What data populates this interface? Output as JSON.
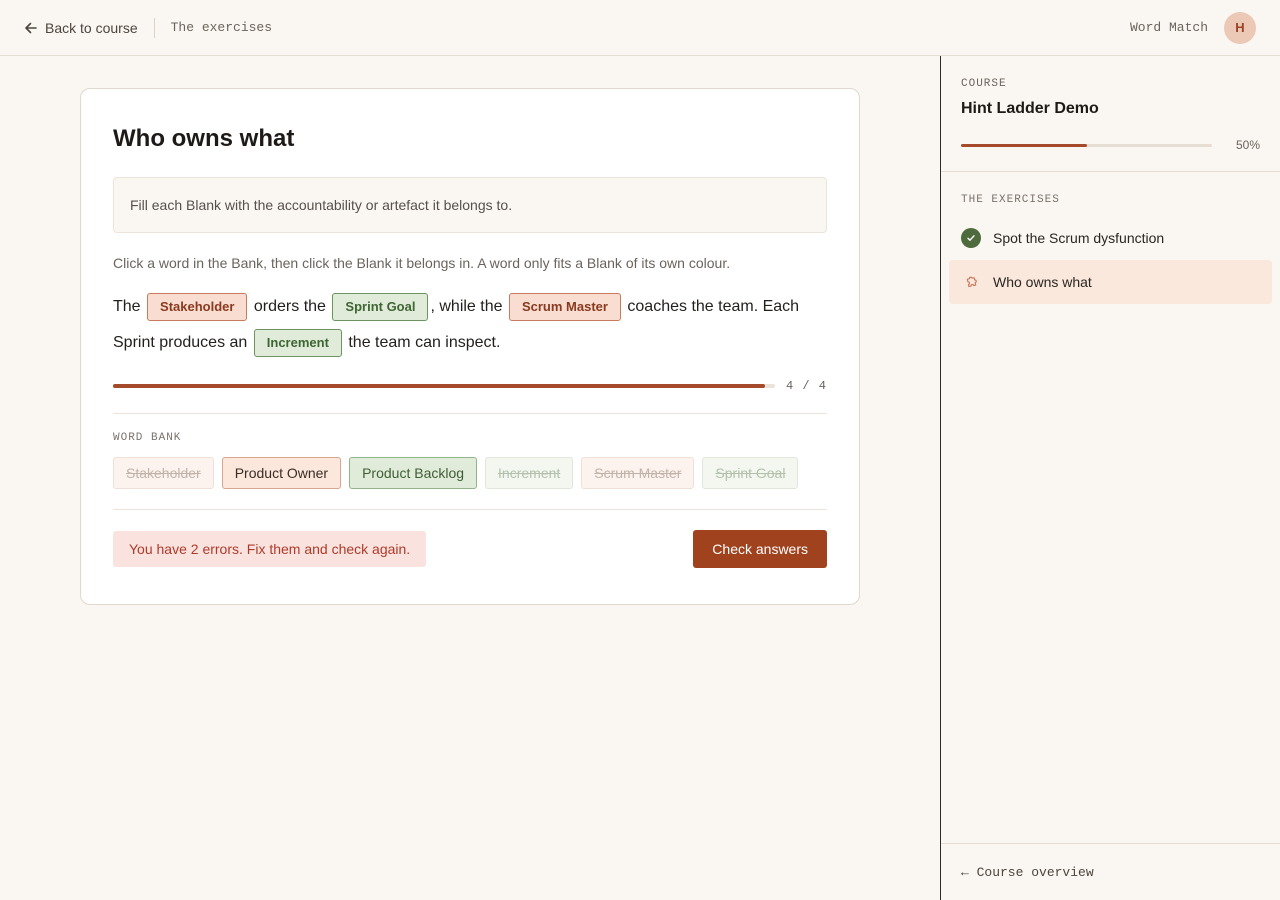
{
  "topbar": {
    "back_label": "Back to course",
    "breadcrumb": "The exercises",
    "app_name": "Word Match",
    "avatar_initial": "H"
  },
  "exercise": {
    "title": "Who owns what",
    "instruction": "Fill each Blank with the accountability or artefact it belongs to.",
    "hint": "Click a word in the Bank, then click the Blank it belongs in. A word only fits a Blank of its own colour.",
    "sentence": {
      "t1": "The",
      "b1": "Stakeholder",
      "t2": "orders the",
      "b2": "Sprint Goal",
      "t3": ", while the",
      "b3": "Scrum Master",
      "t4": "coaches the team. Each Sprint produces an",
      "b4": "Increment",
      "t5": "the team can inspect."
    },
    "progress": {
      "filled": 4,
      "total": 4,
      "fraction": 0.985,
      "label": "4 / 4"
    },
    "word_bank_label": "WORD BANK",
    "word_bank": [
      {
        "word": "Stakeholder",
        "color": "orange",
        "used": true
      },
      {
        "word": "Product Owner",
        "color": "orange",
        "used": false
      },
      {
        "word": "Product Backlog",
        "color": "green",
        "used": false
      },
      {
        "word": "Increment",
        "color": "green",
        "used": true
      },
      {
        "word": "Scrum Master",
        "color": "orange",
        "used": true
      },
      {
        "word": "Sprint Goal",
        "color": "green",
        "used": true
      }
    ],
    "error_message": "You have 2 errors. Fix them and check again.",
    "check_label": "Check answers"
  },
  "sidebar": {
    "course_label": "COURSE",
    "course_title": "Hint Ladder Demo",
    "progress_percent": 50,
    "progress_label": "50%",
    "exercises_label": "THE EXERCISES",
    "exercises": [
      {
        "label": "Spot the Scrum dysfunction",
        "status": "done",
        "icon": "check-circle-icon"
      },
      {
        "label": "Who owns what",
        "status": "active",
        "icon": "puzzle-icon"
      }
    ],
    "overview_link": "← Course overview"
  },
  "colors": {
    "accent": "#a0421e",
    "orange_blank_bg": "#f8ddd0",
    "green_blank_bg": "#e0ecd9",
    "error_bg": "#fae3df",
    "done_green": "#4d6b3c"
  }
}
